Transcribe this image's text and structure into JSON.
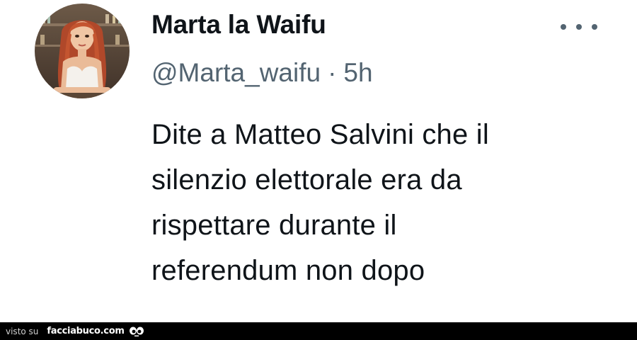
{
  "author": {
    "display_name": "Marta la Waifu",
    "handle": "@Marta_waifu",
    "separator": "·",
    "time": "5h",
    "avatar_icon": "user-avatar-photo"
  },
  "actions": {
    "more_icon": "more-horizontal-icon"
  },
  "tweet": {
    "lines": [
      "Dite a Matteo Salvini che il",
      "silenzio elettorale era da",
      "rispettare durante il",
      "referendum non dopo"
    ]
  },
  "footer": {
    "prefix": "visto su",
    "site": "facciabuco.com",
    "logo_icon": "eyes-icon"
  },
  "colors": {
    "text": "#0f1419",
    "secondary": "#536471",
    "footer_bg": "#000000"
  }
}
